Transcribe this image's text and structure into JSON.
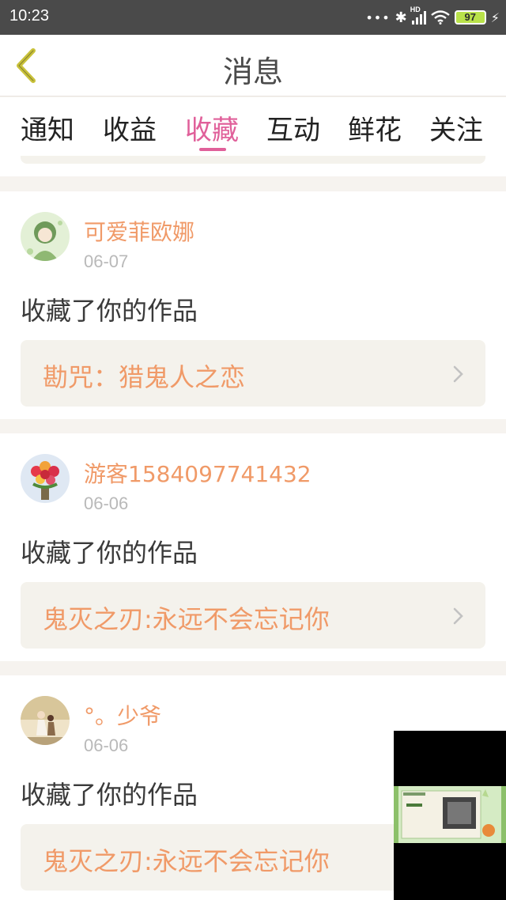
{
  "status_bar": {
    "time": "10:23",
    "dots": "•••",
    "network_label": "HD",
    "battery": "97"
  },
  "header": {
    "title": "消息"
  },
  "tabs": [
    {
      "label": "通知",
      "active": false
    },
    {
      "label": "收益",
      "active": false
    },
    {
      "label": "收藏",
      "active": true
    },
    {
      "label": "互动",
      "active": false
    },
    {
      "label": "鲜花",
      "active": false
    },
    {
      "label": "关注",
      "active": false
    }
  ],
  "messages": [
    {
      "username": "可爱菲欧娜",
      "date": "06-07",
      "action": "收藏了你的作品",
      "work_title": "勘咒：猎鬼人之恋"
    },
    {
      "username": "游客1584097741432",
      "date": "06-06",
      "action": "收藏了你的作品",
      "work_title": "鬼灭之刃:永远不会忘记你"
    },
    {
      "username": "°。少爷",
      "date": "06-06",
      "action": "收藏了你的作品",
      "work_title": "鬼灭之刃:永远不会忘记你"
    }
  ],
  "colors": {
    "accent_pink": "#e0609a",
    "username_orange": "#f09a68",
    "back_arrow": "#c9c23a"
  }
}
